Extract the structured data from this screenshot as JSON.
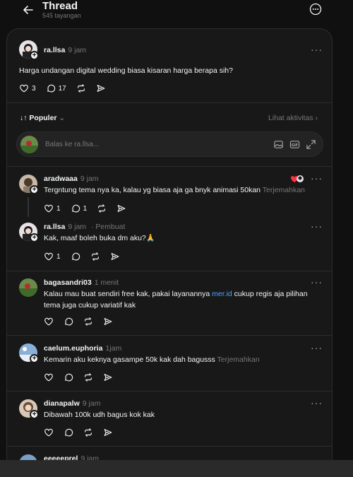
{
  "header": {
    "title": "Thread",
    "subtitle": "545 tayangan"
  },
  "post": {
    "username": "ra.llsa",
    "time": "9 jam",
    "text": "Harga undangan digital wedding biasa kisaran harga berapa sih?",
    "likes": "3",
    "comments": "17"
  },
  "sort": {
    "label": "Populer",
    "activity": "Lihat aktivitas"
  },
  "reply_box": {
    "placeholder": "Balas ke ra.llsa..."
  },
  "replies": [
    {
      "username": "aradwaaa",
      "time": "9 jam",
      "text": "Tergntung tema nya ka, kalau yg biasa aja ga bnyk animasi 50kan",
      "translate": "Terjemahkan",
      "likes": "1",
      "comments": "1"
    },
    {
      "username": "ra.llsa",
      "time": "9 jam",
      "tag": "Pembuat",
      "text": "Kak, maaf boleh buka dm aku?🙏",
      "likes": "1"
    },
    {
      "username": "bagasandri03",
      "time": "1 menit",
      "text_a": "Kalau mau buat sendiri free kak, pakai layanannya ",
      "link": "mer.id",
      "text_b": " cukup regis aja pilihan",
      "text_c": "tema juga cukup variatif kak"
    },
    {
      "username": "caelum.euphoria",
      "time": "1jam",
      "text": "Kemarin aku keknya gasampe 50k kak dah bagusss",
      "translate": "Terjemahkan"
    },
    {
      "username": "dianapalw",
      "time": "9 jam",
      "text": "Dibawah 100k udh bagus kok kak"
    },
    {
      "username": "eeeeeprel",
      "time": "9 jam"
    }
  ],
  "colors": {
    "background": "#101010",
    "card": "#181818",
    "text": "#f3f5f7",
    "muted": "#777777",
    "link": "#4da3ff",
    "divider": "#2d2d2d"
  }
}
